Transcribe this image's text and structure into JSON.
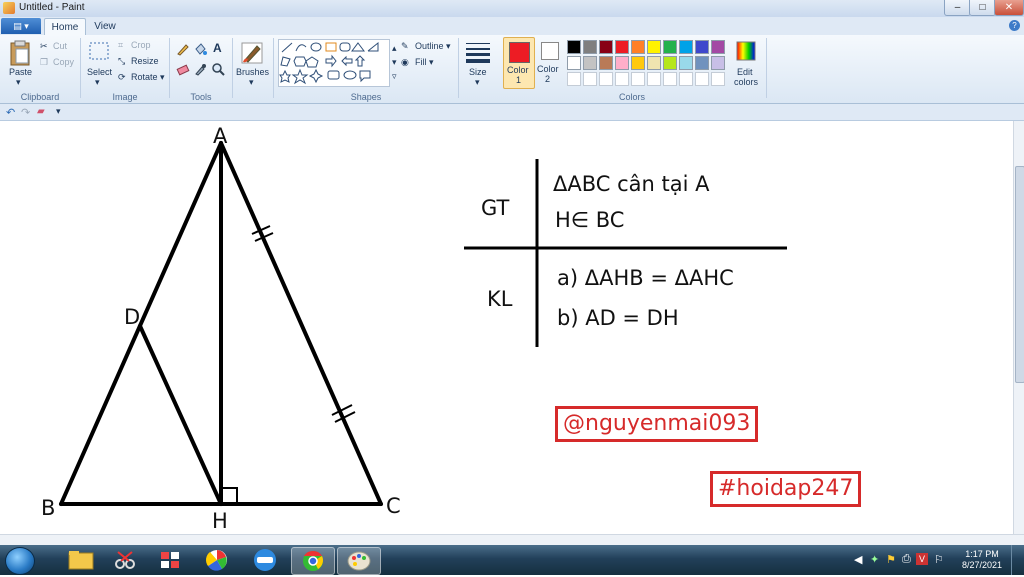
{
  "window": {
    "title": "Untitled - Paint",
    "controls": {
      "minimize": "–",
      "maximize": "□",
      "close": "✕"
    }
  },
  "menu": {
    "app_button": "▤ ▾",
    "tabs": [
      "Home",
      "View"
    ],
    "help": "?"
  },
  "ribbon": {
    "clipboard": {
      "paste": "Paste",
      "cut": "Cut",
      "copy": "Copy",
      "label": "Clipboard"
    },
    "image": {
      "select": "Select",
      "crop": "Crop",
      "resize": "Resize",
      "rotate": "Rotate ▾",
      "label": "Image"
    },
    "tools": {
      "label": "Tools"
    },
    "brushes": {
      "label": "Brushes"
    },
    "shapes": {
      "outline": "Outline ▾",
      "fill": "Fill ▾",
      "label": "Shapes"
    },
    "size": {
      "label": "Size"
    },
    "colors": {
      "color1": "Color\n1",
      "color1_a": "Color",
      "color1_b": "1",
      "color2_a": "Color",
      "color2_b": "2",
      "edit": "Edit\ncolors",
      "edit_a": "Edit",
      "edit_b": "colors",
      "label": "Colors",
      "color1_value": "#ed1c24",
      "color2_value": "#ffffff",
      "palette_row1": [
        "#000000",
        "#7f7f7f",
        "#880015",
        "#ed1c24",
        "#ff7f27",
        "#fff200",
        "#22b14c",
        "#00a2e8",
        "#3f48cc",
        "#a349a4"
      ],
      "palette_row2": [
        "#ffffff",
        "#c3c3c3",
        "#b97a57",
        "#ffaec9",
        "#ffc90e",
        "#efe4b0",
        "#b5e61d",
        "#99d9ea",
        "#7092be",
        "#c8bfe7"
      ]
    }
  },
  "drawing": {
    "points": {
      "A": "A",
      "B": "B",
      "C": "C",
      "D": "D",
      "H": "H"
    },
    "table": {
      "gt_label": "GT",
      "gt_line1": "ΔABC cân tại A",
      "gt_line2": "H∈ BC",
      "kl_label": "KL",
      "kl_line1": "a) ΔAHB = ΔAHC",
      "kl_line2": "b) AD = DH"
    },
    "tag_user": "@nguyenmai093",
    "tag_site": "#hoidap247",
    "accent": "#d62a2a"
  },
  "taskbar": {
    "time": "1:17 PM",
    "date": "8/27/2021"
  }
}
